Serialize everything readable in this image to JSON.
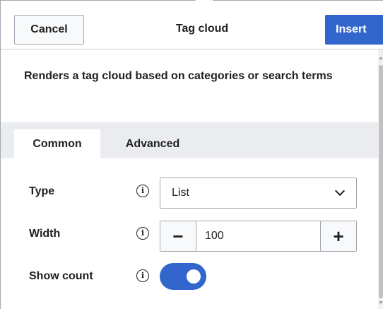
{
  "dialog": {
    "title": "Tag cloud",
    "cancel_label": "Cancel",
    "insert_label": "Insert",
    "description": "Renders a tag cloud based on categories or search terms"
  },
  "tabs": [
    {
      "label": "Common",
      "active": true
    },
    {
      "label": "Advanced",
      "active": false
    }
  ],
  "fields": {
    "type": {
      "label": "Type",
      "value": "List"
    },
    "width": {
      "label": "Width",
      "value": "100",
      "minus": "−",
      "plus": "+"
    },
    "show_count": {
      "label": "Show count",
      "enabled": true
    }
  },
  "icons": {
    "info": "i"
  },
  "colors": {
    "accent": "#3366cc",
    "tab_bar": "#eaecf0"
  }
}
